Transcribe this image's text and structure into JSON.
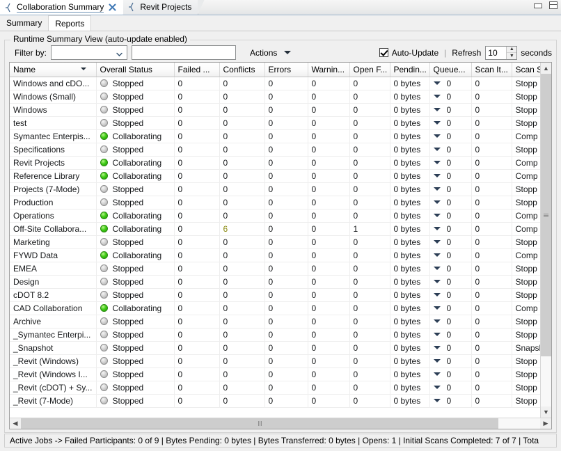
{
  "window": {
    "minimize_label": "minimize",
    "maximize_label": "maximize"
  },
  "tabs": [
    {
      "label": "Collaboration Summary",
      "icon": "perspective-icon",
      "active": true,
      "close_icon": "close-icon"
    },
    {
      "label": "Revit Projects",
      "icon": "perspective-icon",
      "active": false
    }
  ],
  "subtabs": [
    {
      "label": "Summary",
      "active": true
    },
    {
      "label": "Reports",
      "active": false
    }
  ],
  "group": {
    "legend": "Runtime Summary View (auto-update enabled)"
  },
  "filterbar": {
    "filter_label": "Filter by:",
    "filter_combo_value": "",
    "filter_combo_placeholder": "",
    "filter_text_value": "",
    "filter_text_placeholder": "",
    "actions_label": "Actions",
    "auto_update_label": "Auto-Update",
    "auto_update_checked": true,
    "separator": "|",
    "refresh_label": "Refresh",
    "refresh_value": "10",
    "seconds_label": "seconds"
  },
  "table": {
    "columns": [
      {
        "label": "Name",
        "sorted": true
      },
      {
        "label": "Overall Status",
        "sorted": false
      },
      {
        "label": "Failed ...",
        "sorted": false
      },
      {
        "label": "Conflicts",
        "sorted": false
      },
      {
        "label": "Errors",
        "sorted": false
      },
      {
        "label": "Warnin...",
        "sorted": false
      },
      {
        "label": "Open F...",
        "sorted": false
      },
      {
        "label": "Pendin...",
        "sorted": false
      },
      {
        "label": "Queue...",
        "sorted": false
      },
      {
        "label": "Scan It...",
        "sorted": false
      },
      {
        "label": "Scan S",
        "sorted": false
      }
    ],
    "rows": [
      {
        "name": "Windows and cDO...",
        "status": "Stopped",
        "state": "stopped",
        "failed": "0",
        "conflicts": "0",
        "errors": "0",
        "warnings": "0",
        "open_files": "0",
        "pending": "0 bytes",
        "queued": "0",
        "scan_items": "0",
        "scan_status": "Stopp"
      },
      {
        "name": "Windows (Small)",
        "status": "Stopped",
        "state": "stopped",
        "failed": "0",
        "conflicts": "0",
        "errors": "0",
        "warnings": "0",
        "open_files": "0",
        "pending": "0 bytes",
        "queued": "0",
        "scan_items": "0",
        "scan_status": "Stopp"
      },
      {
        "name": "Windows",
        "status": "Stopped",
        "state": "stopped",
        "failed": "0",
        "conflicts": "0",
        "errors": "0",
        "warnings": "0",
        "open_files": "0",
        "pending": "0 bytes",
        "queued": "0",
        "scan_items": "0",
        "scan_status": "Stopp"
      },
      {
        "name": "test",
        "status": "Stopped",
        "state": "stopped",
        "failed": "0",
        "conflicts": "0",
        "errors": "0",
        "warnings": "0",
        "open_files": "0",
        "pending": "0 bytes",
        "queued": "0",
        "scan_items": "0",
        "scan_status": "Stopp"
      },
      {
        "name": "Symantec Enterpis...",
        "status": "Collaborating",
        "state": "collaborating",
        "failed": "0",
        "conflicts": "0",
        "errors": "0",
        "warnings": "0",
        "open_files": "0",
        "pending": "0 bytes",
        "queued": "0",
        "scan_items": "0",
        "scan_status": "Comp"
      },
      {
        "name": "Specifications",
        "status": "Stopped",
        "state": "stopped",
        "failed": "0",
        "conflicts": "0",
        "errors": "0",
        "warnings": "0",
        "open_files": "0",
        "pending": "0 bytes",
        "queued": "0",
        "scan_items": "0",
        "scan_status": "Stopp"
      },
      {
        "name": "Revit Projects",
        "status": "Collaborating",
        "state": "collaborating",
        "failed": "0",
        "conflicts": "0",
        "errors": "0",
        "warnings": "0",
        "open_files": "0",
        "pending": "0 bytes",
        "queued": "0",
        "scan_items": "0",
        "scan_status": "Comp"
      },
      {
        "name": "Reference Library",
        "status": "Collaborating",
        "state": "collaborating",
        "failed": "0",
        "conflicts": "0",
        "errors": "0",
        "warnings": "0",
        "open_files": "0",
        "pending": "0 bytes",
        "queued": "0",
        "scan_items": "0",
        "scan_status": "Comp"
      },
      {
        "name": "Projects (7-Mode)",
        "status": "Stopped",
        "state": "stopped",
        "failed": "0",
        "conflicts": "0",
        "errors": "0",
        "warnings": "0",
        "open_files": "0",
        "pending": "0 bytes",
        "queued": "0",
        "scan_items": "0",
        "scan_status": "Stopp"
      },
      {
        "name": "Production",
        "status": "Stopped",
        "state": "stopped",
        "failed": "0",
        "conflicts": "0",
        "errors": "0",
        "warnings": "0",
        "open_files": "0",
        "pending": "0 bytes",
        "queued": "0",
        "scan_items": "0",
        "scan_status": "Stopp"
      },
      {
        "name": "Operations",
        "status": "Collaborating",
        "state": "collaborating",
        "failed": "0",
        "conflicts": "0",
        "errors": "0",
        "warnings": "0",
        "open_files": "0",
        "pending": "0 bytes",
        "queued": "0",
        "scan_items": "0",
        "scan_status": "Comp"
      },
      {
        "name": "Off-Site Collabora...",
        "status": "Collaborating",
        "state": "collaborating",
        "failed": "0",
        "conflicts": "6",
        "conflicts_warn": true,
        "errors": "0",
        "warnings": "0",
        "open_files": "1",
        "pending": "0 bytes",
        "queued": "0",
        "scan_items": "0",
        "scan_status": "Comp"
      },
      {
        "name": "Marketing",
        "status": "Stopped",
        "state": "stopped",
        "failed": "0",
        "conflicts": "0",
        "errors": "0",
        "warnings": "0",
        "open_files": "0",
        "pending": "0 bytes",
        "queued": "0",
        "scan_items": "0",
        "scan_status": "Stopp"
      },
      {
        "name": "FYWD Data",
        "status": "Collaborating",
        "state": "collaborating",
        "failed": "0",
        "conflicts": "0",
        "errors": "0",
        "warnings": "0",
        "open_files": "0",
        "pending": "0 bytes",
        "queued": "0",
        "scan_items": "0",
        "scan_status": "Comp"
      },
      {
        "name": "EMEA",
        "status": "Stopped",
        "state": "stopped",
        "failed": "0",
        "conflicts": "0",
        "errors": "0",
        "warnings": "0",
        "open_files": "0",
        "pending": "0 bytes",
        "queued": "0",
        "scan_items": "0",
        "scan_status": "Stopp"
      },
      {
        "name": "Design",
        "status": "Stopped",
        "state": "stopped",
        "failed": "0",
        "conflicts": "0",
        "errors": "0",
        "warnings": "0",
        "open_files": "0",
        "pending": "0 bytes",
        "queued": "0",
        "scan_items": "0",
        "scan_status": "Stopp"
      },
      {
        "name": "cDOT 8.2",
        "status": "Stopped",
        "state": "stopped",
        "failed": "0",
        "conflicts": "0",
        "errors": "0",
        "warnings": "0",
        "open_files": "0",
        "pending": "0 bytes",
        "queued": "0",
        "scan_items": "0",
        "scan_status": "Stopp"
      },
      {
        "name": "CAD Collaboration",
        "status": "Collaborating",
        "state": "collaborating",
        "failed": "0",
        "conflicts": "0",
        "errors": "0",
        "warnings": "0",
        "open_files": "0",
        "pending": "0 bytes",
        "queued": "0",
        "scan_items": "0",
        "scan_status": "Comp"
      },
      {
        "name": "Archive",
        "status": "Stopped",
        "state": "stopped",
        "failed": "0",
        "conflicts": "0",
        "errors": "0",
        "warnings": "0",
        "open_files": "0",
        "pending": "0 bytes",
        "queued": "0",
        "scan_items": "0",
        "scan_status": "Stopp"
      },
      {
        "name": "_Symantec Enterpi...",
        "status": "Stopped",
        "state": "stopped",
        "failed": "0",
        "conflicts": "0",
        "errors": "0",
        "warnings": "0",
        "open_files": "0",
        "pending": "0 bytes",
        "queued": "0",
        "scan_items": "0",
        "scan_status": "Stopp"
      },
      {
        "name": "_Snapshot",
        "status": "Stopped",
        "state": "stopped",
        "failed": "0",
        "conflicts": "0",
        "errors": "0",
        "warnings": "0",
        "open_files": "0",
        "pending": "0 bytes",
        "queued": "0",
        "scan_items": "0",
        "scan_status": "Snapsh"
      },
      {
        "name": "_Revit (Windows)",
        "status": "Stopped",
        "state": "stopped",
        "failed": "0",
        "conflicts": "0",
        "errors": "0",
        "warnings": "0",
        "open_files": "0",
        "pending": "0 bytes",
        "queued": "0",
        "scan_items": "0",
        "scan_status": "Stopp"
      },
      {
        "name": "_Revit (Windows I...",
        "status": "Stopped",
        "state": "stopped",
        "failed": "0",
        "conflicts": "0",
        "errors": "0",
        "warnings": "0",
        "open_files": "0",
        "pending": "0 bytes",
        "queued": "0",
        "scan_items": "0",
        "scan_status": "Stopp"
      },
      {
        "name": "_Revit (cDOT) + Sy...",
        "status": "Stopped",
        "state": "stopped",
        "failed": "0",
        "conflicts": "0",
        "errors": "0",
        "warnings": "0",
        "open_files": "0",
        "pending": "0 bytes",
        "queued": "0",
        "scan_items": "0",
        "scan_status": "Stopp"
      },
      {
        "name": "_Revit (7-Mode)",
        "status": "Stopped",
        "state": "stopped",
        "failed": "0",
        "conflicts": "0",
        "errors": "0",
        "warnings": "0",
        "open_files": "0",
        "pending": "0 bytes",
        "queued": "0",
        "scan_items": "0",
        "scan_status": "Stopp"
      }
    ]
  },
  "statusbar": {
    "text": "Active Jobs -> Failed Participants: 0 of 9  |  Bytes Pending: 0 bytes  |  Bytes Transferred: 0 bytes  |  Opens: 1  |  Initial Scans Completed: 7 of 7  |  Tota"
  },
  "colors": {
    "accent": "#9ab3cc",
    "status_running": "#41cc17",
    "status_stopped": "#a8a8a8",
    "warning_value": "#8a8a11"
  }
}
